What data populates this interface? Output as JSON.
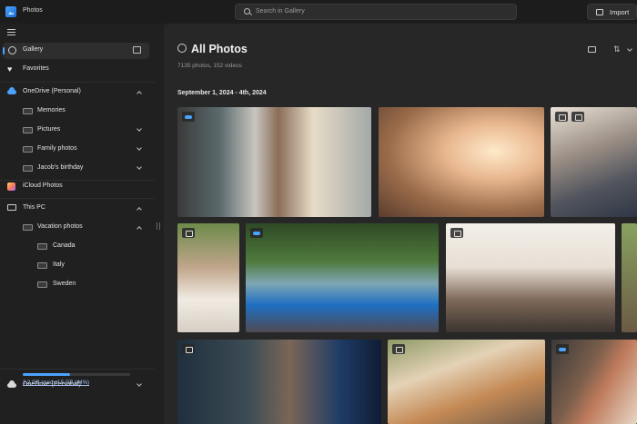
{
  "window": {
    "app_title": "Photos"
  },
  "search": {
    "placeholder": "Search in Gallery"
  },
  "toolbar": {
    "import_label": "Import"
  },
  "sidebar": {
    "items": [
      {
        "label": "Gallery"
      },
      {
        "label": "Favorites"
      },
      {
        "label": "OneDrive (Personal)"
      },
      {
        "label": "Memories"
      },
      {
        "label": "Pictures"
      },
      {
        "label": "Family photos"
      },
      {
        "label": "Jacob's birthday"
      },
      {
        "label": "iCloud Photos"
      },
      {
        "label": "This PC"
      },
      {
        "label": "Vacation photos"
      },
      {
        "label": "Canada"
      },
      {
        "label": "Italy"
      },
      {
        "label": "Sweden"
      }
    ],
    "footer": {
      "account_label": "OneDrive (Personal)",
      "storage_text": "2.2 GB used of 5 GB (44%)",
      "storage_fraction": 0.44
    }
  },
  "main": {
    "title": "All Photos",
    "subtitle": "7135 photos, 152 videos",
    "date_header": "September 1, 2024 - 4th, 2024"
  },
  "colors": {
    "accent": "#4aa3ff",
    "background": "#202020",
    "panel": "#272727"
  }
}
